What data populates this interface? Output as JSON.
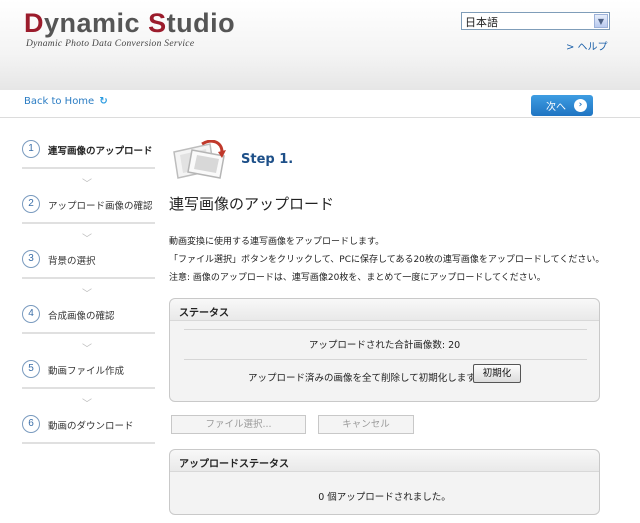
{
  "brand": {
    "logo_word1_cap": "D",
    "logo_word1_rest": "ynamic",
    "logo_word2_cap": "S",
    "logo_word2_rest": "tudio",
    "tagline": "Dynamic Photo Data Conversion Service",
    "accent": "#9b1c2c"
  },
  "header": {
    "language_value": "日本語",
    "help_link": "> ヘルプ"
  },
  "nav": {
    "back_home": "Back to Home",
    "next": "次へ"
  },
  "steps": [
    {
      "num": "1",
      "label": "連写画像のアップロード"
    },
    {
      "num": "2",
      "label": "アップロード画像の確認"
    },
    {
      "num": "3",
      "label": "背景の選択"
    },
    {
      "num": "4",
      "label": "合成画像の確認"
    },
    {
      "num": "5",
      "label": "動画ファイル作成"
    },
    {
      "num": "6",
      "label": "動画のダウンロード"
    }
  ],
  "main": {
    "step_title": "Step 1.",
    "page_title": "連写画像のアップロード",
    "desc": [
      "動画変換に使用する連写画像をアップロードします。",
      "「ファイル選択」ボタンをクリックして、PCに保存してある20枚の連写画像をアップロードしてください。",
      "注意: 画像のアップロードは、連写画像20枚を、まとめて一度にアップロードしてください。"
    ],
    "status": {
      "title": "ステータス",
      "total_label": "アップロードされた合計画像数: 20",
      "reset_text": "アップロード済みの画像を全て削除して初期化します。",
      "reset_button": "初期化"
    },
    "file_select_button": "ファイル選択...",
    "cancel_button": "キャンセル",
    "upload_status": {
      "title": "アップロードステータス",
      "message": "0 個アップロードされました。"
    }
  }
}
